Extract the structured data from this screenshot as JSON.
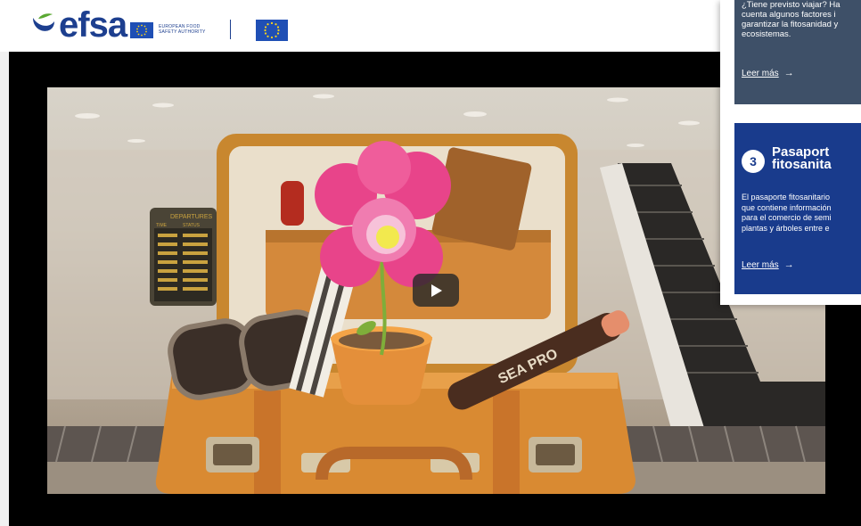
{
  "header": {
    "logo_text": "efsa",
    "eu_caption": "EUROPEAN FOOD SAFETY AUTHORITY"
  },
  "video": {
    "scene": {
      "departures_board_label": "DEPARTURES",
      "board_time_label": "TIME",
      "board_status_label": "STATUS",
      "sunscreen_label": "SEA PRO"
    },
    "play_icon": "play-icon"
  },
  "cards": [
    {
      "body_lines": [
        "¿Tiene previsto viajar? Ha",
        "cuenta algunos factores i",
        "garantizar la fitosanidad y",
        "ecosistemas."
      ],
      "link_label": "Leer más",
      "link_icon": "arrow-right-icon"
    },
    {
      "number": "3",
      "title_lines": [
        "Pasaport",
        "fitosanita"
      ],
      "body_lines": [
        "El pasaporte fitosanitario",
        "que contiene información",
        "para el comercio de semi",
        "plantas y árboles entre e"
      ],
      "link_label": "Leer más",
      "link_icon": "arrow-right-icon"
    }
  ],
  "colors": {
    "brand_blue": "#1d3f8f",
    "card_gray": "#3e5068",
    "card_navy": "#193b8c",
    "eu_blue": "#1f4fb5",
    "eu_star": "#ffd617"
  }
}
